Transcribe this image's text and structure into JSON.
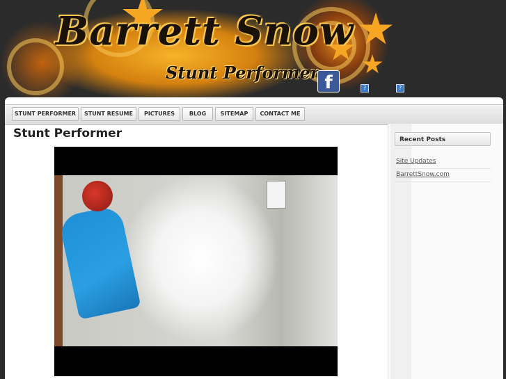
{
  "header": {
    "site_title": "Barrett Snow",
    "tagline": "Stunt Performer",
    "facebook_icon": "facebook-icon",
    "small_icons": [
      "broken-image-icon",
      "broken-image-icon"
    ],
    "small_icon_glyph": "?"
  },
  "nav": {
    "items": [
      "STUNT PERFORMER",
      "STUNT RESUME",
      "PICTURES",
      "BLOG",
      "SITEMAP",
      "CONTACT ME"
    ]
  },
  "main": {
    "title": "Stunt Performer",
    "video": {
      "description_icon": "video-player-icon"
    }
  },
  "sidebar": {
    "widget_title": "Recent Posts",
    "posts": [
      "Site Updates",
      "BarrettSnow.com"
    ]
  },
  "colors": {
    "accent_orange": "#f6a623",
    "header_bg": "#2b2b2b",
    "facebook_blue": "#3b5998"
  }
}
